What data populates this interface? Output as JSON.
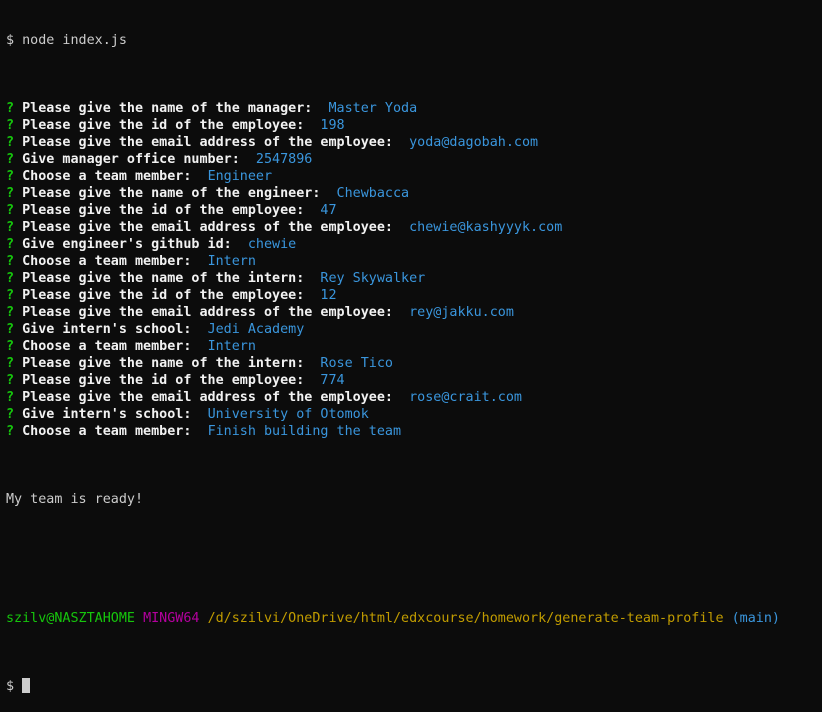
{
  "command": {
    "prompt_symbol": "$",
    "text": "node index.js"
  },
  "qa": [
    {
      "mark": "?",
      "question": "Please give the name of the manager:",
      "answer": "Master Yoda"
    },
    {
      "mark": "?",
      "question": "Please give the id of the employee:",
      "answer": "198"
    },
    {
      "mark": "?",
      "question": "Please give the email address of the employee:",
      "answer": "yoda@dagobah.com"
    },
    {
      "mark": "?",
      "question": "Give manager office number:",
      "answer": "2547896"
    },
    {
      "mark": "?",
      "question": "Choose a team member:",
      "answer": "Engineer"
    },
    {
      "mark": "?",
      "question": "Please give the name of the engineer:",
      "answer": "Chewbacca"
    },
    {
      "mark": "?",
      "question": "Please give the id of the employee:",
      "answer": "47"
    },
    {
      "mark": "?",
      "question": "Please give the email address of the employee:",
      "answer": "chewie@kashyyyk.com"
    },
    {
      "mark": "?",
      "question": "Give engineer's github id:",
      "answer": "chewie"
    },
    {
      "mark": "?",
      "question": "Choose a team member:",
      "answer": "Intern"
    },
    {
      "mark": "?",
      "question": "Please give the name of the intern:",
      "answer": "Rey Skywalker"
    },
    {
      "mark": "?",
      "question": "Please give the id of the employee:",
      "answer": "12"
    },
    {
      "mark": "?",
      "question": "Please give the email address of the employee:",
      "answer": "rey@jakku.com"
    },
    {
      "mark": "?",
      "question": "Give intern's school:",
      "answer": "Jedi Academy"
    },
    {
      "mark": "?",
      "question": "Choose a team member:",
      "answer": "Intern"
    },
    {
      "mark": "?",
      "question": "Please give the name of the intern:",
      "answer": "Rose Tico"
    },
    {
      "mark": "?",
      "question": "Please give the id of the employee:",
      "answer": "774"
    },
    {
      "mark": "?",
      "question": "Please give the email address of the employee:",
      "answer": "rose@crait.com"
    },
    {
      "mark": "?",
      "question": "Give intern's school:",
      "answer": "University of Otomok"
    },
    {
      "mark": "?",
      "question": "Choose a team member:",
      "answer": "Finish building the team"
    }
  ],
  "done_message": "My team is ready!",
  "shell_prompt": {
    "user_host": "szilv@NASZTAHOME",
    "shell": "MINGW64",
    "path": "/d/szilvi/OneDrive/html/edxcourse/homework/generate-team-profile",
    "branch": "(main)",
    "symbol": "$"
  },
  "colors": {
    "background": "#0c0c0c",
    "question_mark": "#16c60c",
    "answer": "#3a96dd",
    "shell_name": "#b4009e",
    "path": "#c19c00"
  }
}
